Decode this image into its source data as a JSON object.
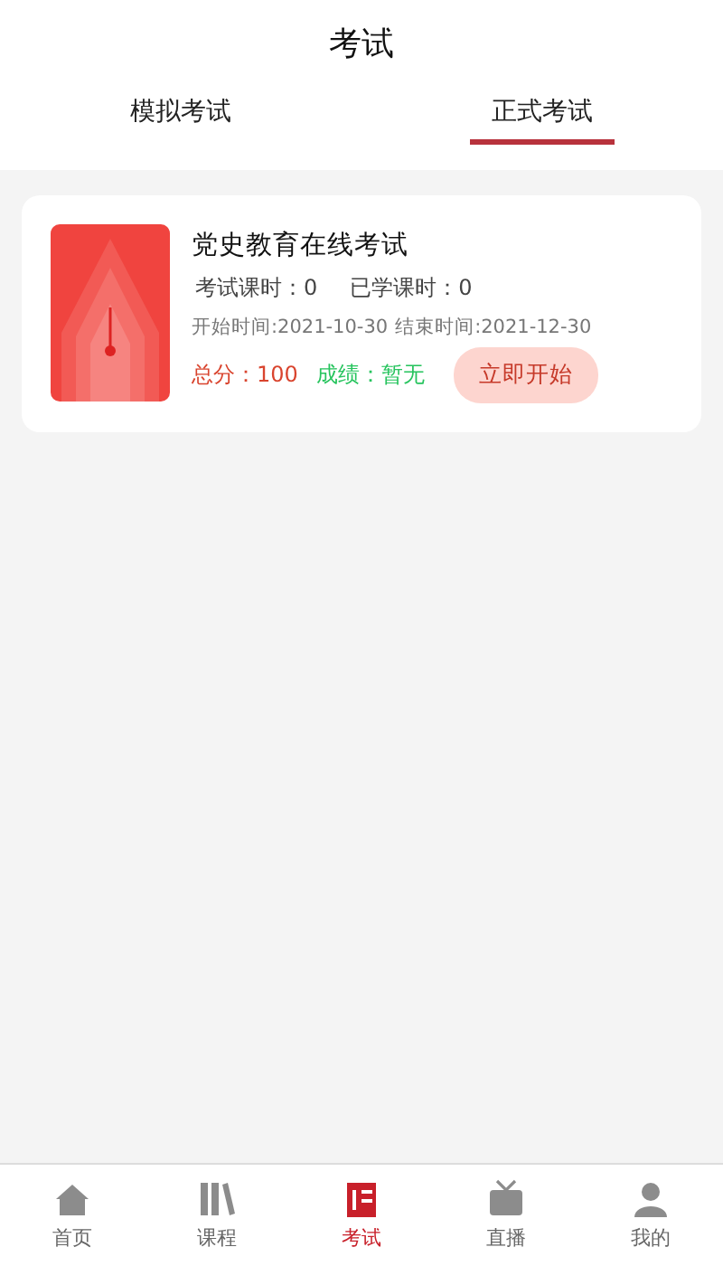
{
  "header": {
    "title": "考试"
  },
  "tabs": [
    {
      "label": "模拟考试",
      "selected": false
    },
    {
      "label": "正式考试",
      "selected": true
    }
  ],
  "exams": [
    {
      "title": "党史教育在线考试",
      "exam_hours": "考试课时：0",
      "studied_hours": "已学课时：0",
      "start": "开始时间:2021-10-30",
      "end": "结束时间:2021-12-30",
      "total": "总分：100",
      "score": "成绩：暂无",
      "action": "立即开始"
    }
  ],
  "nav": [
    {
      "label": "首页",
      "kind": "home",
      "selected": false
    },
    {
      "label": "课程",
      "kind": "books",
      "selected": false
    },
    {
      "label": "考试",
      "kind": "exam",
      "selected": true
    },
    {
      "label": "直播",
      "kind": "tv",
      "selected": false
    },
    {
      "label": "我的",
      "kind": "person",
      "selected": false
    }
  ]
}
